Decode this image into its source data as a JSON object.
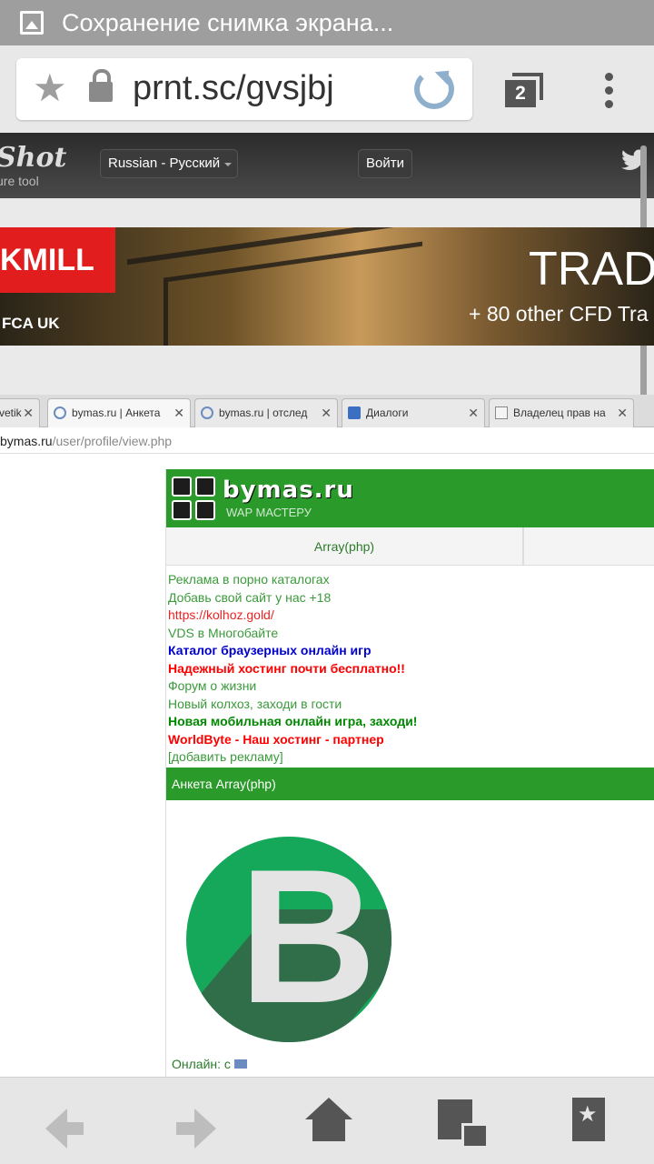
{
  "status_bar": {
    "title": "Сохранение снимка экрана..."
  },
  "browser": {
    "url": "prnt.sc/gvsjbj",
    "tab_count": "2"
  },
  "lightshot": {
    "logo": "Shot",
    "tagline": "ure tool",
    "language": "Russian - Русский",
    "login": "Войти"
  },
  "ad": {
    "brand": "KMILL",
    "fca": "FCA UK",
    "headline": "TRADI",
    "subline": "+ 80 other CFD Tra"
  },
  "inner_browser": {
    "tabs": [
      {
        "label": "vetik",
        "icon": ""
      },
      {
        "label": "bymas.ru | Анкета",
        "icon": "wifi-icon"
      },
      {
        "label": "bymas.ru | отслед",
        "icon": "wifi-icon"
      },
      {
        "label": "Диалоги",
        "icon": "dialog-icon"
      },
      {
        "label": "Владелец прав на",
        "icon": "vc-icon"
      }
    ],
    "close_glyph": "✕",
    "url_host": "bymas.ru",
    "url_path": "/user/profile/view.php"
  },
  "site": {
    "name": "bymas.ru",
    "tagline": "WAP МАСТЕРУ",
    "nav_item": "Array(php)",
    "links": [
      {
        "text": "Реклама в порно каталогах",
        "style": "c-green"
      },
      {
        "text": "Добавь свой сайт у нас +18",
        "style": "c-green"
      },
      {
        "text": "https://kolhoz.gold/",
        "style": "c-red"
      },
      {
        "text": "VDS в Многобайте",
        "style": "c-green"
      },
      {
        "text": "Каталог браузерных онлайн игр",
        "style": "c-blue"
      },
      {
        "text": "Надежный хостинг почти бесплатно!!",
        "style": "c-redb"
      },
      {
        "text": "Форум о жизни",
        "style": "c-green"
      },
      {
        "text": "Новый колхоз, заходи в гости",
        "style": "c-green"
      },
      {
        "text": "Новая мобильная онлайн игра, заходи!",
        "style": "c-greenb"
      },
      {
        "text": "WorldByte - Наш хостинг - партнер",
        "style": "c-redb"
      },
      {
        "text": "[добавить рекламу]",
        "style": "c-green"
      }
    ],
    "profile_title": "Анкета Array(php)",
    "avatar_letter": "B",
    "online": "Онлайн: с"
  },
  "colors": {
    "site_green": "#2a9a2a",
    "avatar_green": "#16a85a",
    "ad_red": "#e11d1d"
  }
}
